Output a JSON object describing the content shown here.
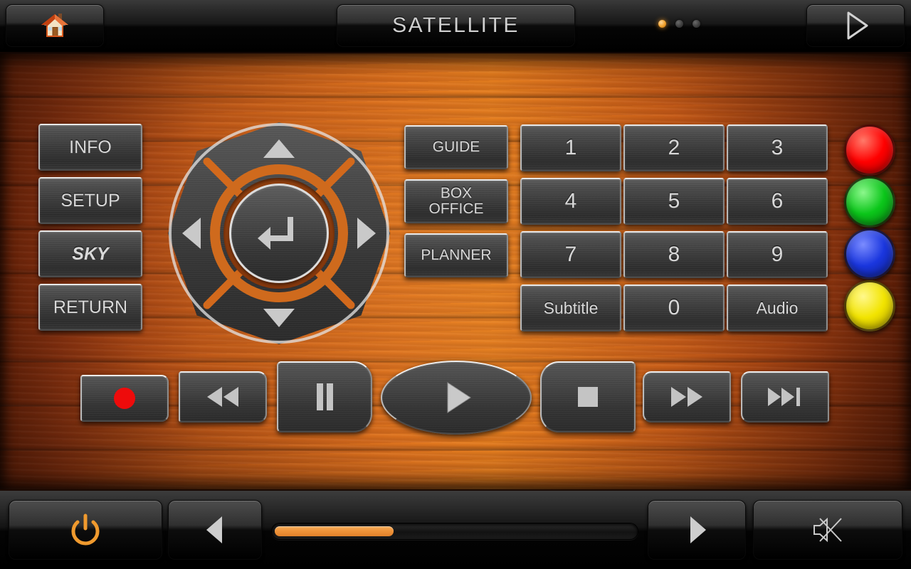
{
  "topbar": {
    "home_icon": "home-icon",
    "title": "SATELLITE",
    "next_icon": "triangle-right-outline-icon",
    "page_dots": {
      "total": 3,
      "active_index": 0
    }
  },
  "left_column": [
    {
      "label": "INFO",
      "name": "info"
    },
    {
      "label": "SETUP",
      "name": "setup"
    },
    {
      "label": "SKY",
      "name": "sky"
    },
    {
      "label": "RETURN",
      "name": "return"
    }
  ],
  "dpad": {
    "up": "▲",
    "down": "▼",
    "left": "◀",
    "right": "▶",
    "center_label": "enter-icon"
  },
  "function_column": [
    {
      "label": "GUIDE",
      "name": "guide"
    },
    {
      "label": "BOX OFFICE",
      "line1": "BOX",
      "line2": "OFFICE",
      "name": "box-office"
    },
    {
      "label": "PLANNER",
      "name": "planner"
    }
  ],
  "keypad": [
    {
      "label": "1",
      "name": "1"
    },
    {
      "label": "2",
      "name": "2"
    },
    {
      "label": "3",
      "name": "3"
    },
    {
      "label": "4",
      "name": "4"
    },
    {
      "label": "5",
      "name": "5"
    },
    {
      "label": "6",
      "name": "6"
    },
    {
      "label": "7",
      "name": "7"
    },
    {
      "label": "8",
      "name": "8"
    },
    {
      "label": "9",
      "name": "9"
    },
    {
      "label": "Subtitle",
      "name": "subtitle"
    },
    {
      "label": "0",
      "name": "0"
    },
    {
      "label": "Audio",
      "name": "audio"
    }
  ],
  "color_buttons": [
    {
      "name": "red",
      "color": "#FF0000"
    },
    {
      "name": "green",
      "color": "#0BC61A"
    },
    {
      "name": "blue",
      "color": "#1A36DE"
    },
    {
      "name": "yellow",
      "color": "#F2E400"
    }
  ],
  "transport": [
    {
      "name": "record",
      "icon": "record-icon"
    },
    {
      "name": "rewind",
      "icon": "rewind-icon"
    },
    {
      "name": "pause",
      "icon": "pause-icon"
    },
    {
      "name": "play",
      "icon": "play-icon"
    },
    {
      "name": "stop",
      "icon": "stop-icon"
    },
    {
      "name": "fast-forward",
      "icon": "fast-forward-icon"
    },
    {
      "name": "skip-next",
      "icon": "skip-next-icon"
    }
  ],
  "bottombar": {
    "power_icon": "power-icon",
    "prev_icon": "triangle-left-icon",
    "next_icon": "triangle-right-icon",
    "mute_icon": "mute-icon",
    "progress": {
      "value": 33,
      "max": 100
    }
  },
  "colors": {
    "accent_orange": "#EF9339",
    "wood_light": "#E8801F",
    "wood_dark": "#6E2409",
    "metal_face": "#3A3A3A",
    "text": "#D8D8D8"
  }
}
